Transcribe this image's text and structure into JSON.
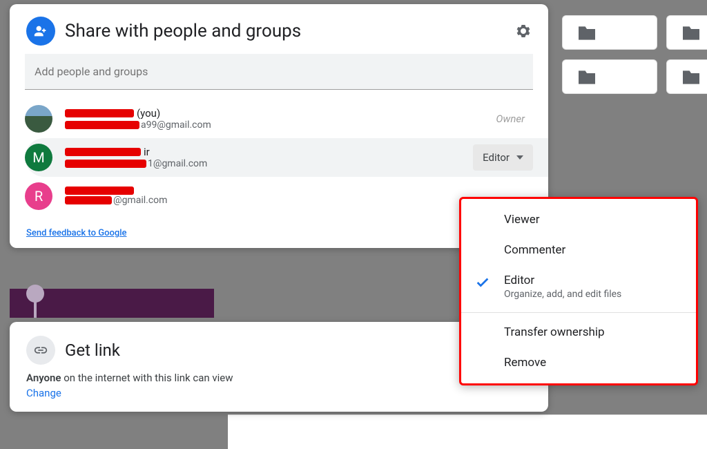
{
  "share": {
    "title": "Share with people and groups",
    "input_placeholder": "Add people and groups",
    "feedback": "Send feedback to Google",
    "owner_label": "Owner",
    "you_suffix": "(you)",
    "role_button": "Editor",
    "people": [
      {
        "avatar_letter": "",
        "email_suffix": "a99@gmail.com"
      },
      {
        "avatar_letter": "M",
        "name_suffix": "ir",
        "email_suffix": "1@gmail.com"
      },
      {
        "avatar_letter": "R",
        "email_suffix": "@gmail.com"
      }
    ]
  },
  "link": {
    "title": "Get link",
    "desc_bold": "Anyone",
    "desc_rest": " on the internet with this link can view",
    "change": "Change"
  },
  "menu": {
    "viewer": "Viewer",
    "commenter": "Commenter",
    "editor": "Editor",
    "editor_sub": "Organize, add, and edit files",
    "transfer": "Transfer ownership",
    "remove": "Remove"
  }
}
